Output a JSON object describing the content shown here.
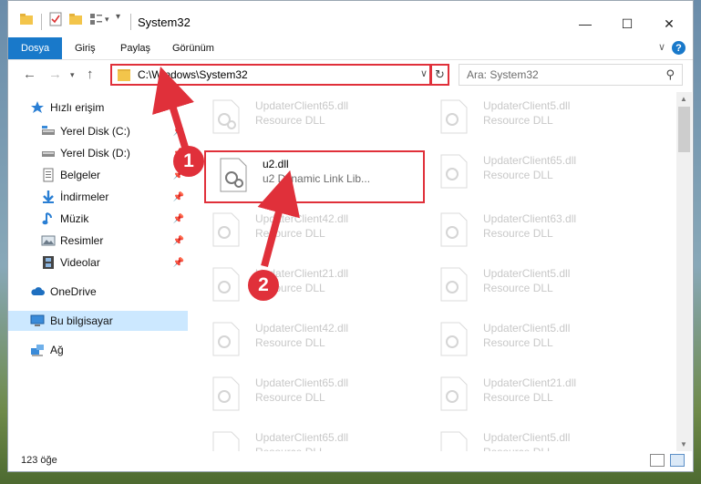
{
  "window": {
    "title": "System32",
    "controls": {
      "minimize": "—",
      "maximize": "☐",
      "close": "✕"
    }
  },
  "ribbon": {
    "tabs": [
      "Dosya",
      "Giriş",
      "Paylaş",
      "Görünüm"
    ],
    "expand_icon": "chevron-down-icon",
    "help": "?"
  },
  "nav": {
    "address": "C:\\Windows\\System32",
    "search_placeholder": "Ara: System32"
  },
  "sidebar": {
    "quick_access": "Hızlı erişim",
    "items": [
      {
        "label": "Yerel Disk (C:)",
        "pinned": true
      },
      {
        "label": "Yerel Disk (D:)",
        "pinned": true
      },
      {
        "label": "Belgeler",
        "pinned": true
      },
      {
        "label": "İndirmeler",
        "pinned": true
      },
      {
        "label": "Müzik",
        "pinned": true
      },
      {
        "label": "Resimler",
        "pinned": true
      },
      {
        "label": "Videolar",
        "pinned": true
      }
    ],
    "onedrive": "OneDrive",
    "this_pc": "Bu bilgisayar",
    "network": "Ağ"
  },
  "files": {
    "left": [
      {
        "name": "UpdaterClient65.dll",
        "type": "Resource DLL"
      },
      {
        "name": "u2.dll",
        "type": "u2 Dynamic Link Lib..."
      },
      {
        "name": "UpdaterClient42.dll",
        "type": "Resource DLL"
      },
      {
        "name": "UpdaterClient21.dll",
        "type": "Resource DLL"
      },
      {
        "name": "UpdaterClient42.dll",
        "type": "Resource DLL"
      },
      {
        "name": "UpdaterClient65.dll",
        "type": "Resource DLL"
      },
      {
        "name": "UpdaterClient65.dll",
        "type": "Resource DLL"
      }
    ],
    "right": [
      {
        "name": "UpdaterClient5.dll",
        "type": "Resource DLL"
      },
      {
        "name": "UpdaterClient65.dll",
        "type": "Resource DLL"
      },
      {
        "name": "UpdaterClient63.dll",
        "type": "Resource DLL"
      },
      {
        "name": "UpdaterClient5.dll",
        "type": "Resource DLL"
      },
      {
        "name": "UpdaterClient5.dll",
        "type": "Resource DLL"
      },
      {
        "name": "UpdaterClient21.dll",
        "type": "Resource DLL"
      },
      {
        "name": "UpdaterClient5.dll",
        "type": "Resource DLL"
      }
    ]
  },
  "status": {
    "count": "123 öğe"
  },
  "annotations": {
    "step1": "1",
    "step2": "2"
  },
  "colors": {
    "accent": "#1979ca",
    "highlight": "#e0303a",
    "selection": "#cce8ff"
  }
}
